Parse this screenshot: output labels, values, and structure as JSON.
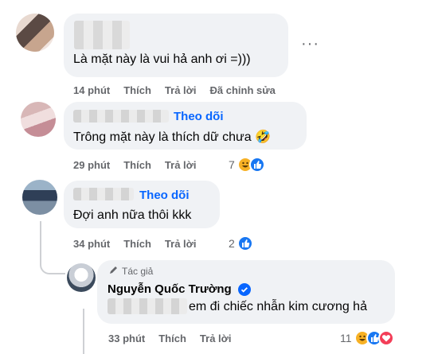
{
  "comments": [
    {
      "text": "Là mặt này là vui hả anh ơi =)))",
      "time": "14 phút",
      "like_label": "Thích",
      "reply_label": "Trả lời",
      "edited_label": "Đã chỉnh sửa",
      "more_label": "···"
    },
    {
      "follow_label": "Theo dõi",
      "text": "Trông mặt này là thích dữ chưa 🤣",
      "time": "29 phút",
      "like_label": "Thích",
      "reply_label": "Trả lời",
      "reaction_count": "7"
    },
    {
      "follow_label": "Theo dõi",
      "text": "Đợi anh nữa thôi kkk",
      "time": "34 phút",
      "like_label": "Thích",
      "reply_label": "Trả lời",
      "reaction_count": "2"
    }
  ],
  "reply": {
    "author_badge": "Tác giả",
    "author_name": "Nguyễn Quốc Trường",
    "text": "em đi chiếc nhẫn kim cương hả",
    "time": "33 phút",
    "like_label": "Thích",
    "reply_label": "Trả lời",
    "reaction_count": "11"
  },
  "icons": {
    "haha": "haha-react-icon",
    "like": "like-react-icon",
    "love": "love-react-icon",
    "verified": "verified-badge-icon",
    "pen": "pen-icon"
  },
  "colors": {
    "link": "#0866ff",
    "bubble": "#f0f2f5",
    "meta": "#65676b"
  }
}
